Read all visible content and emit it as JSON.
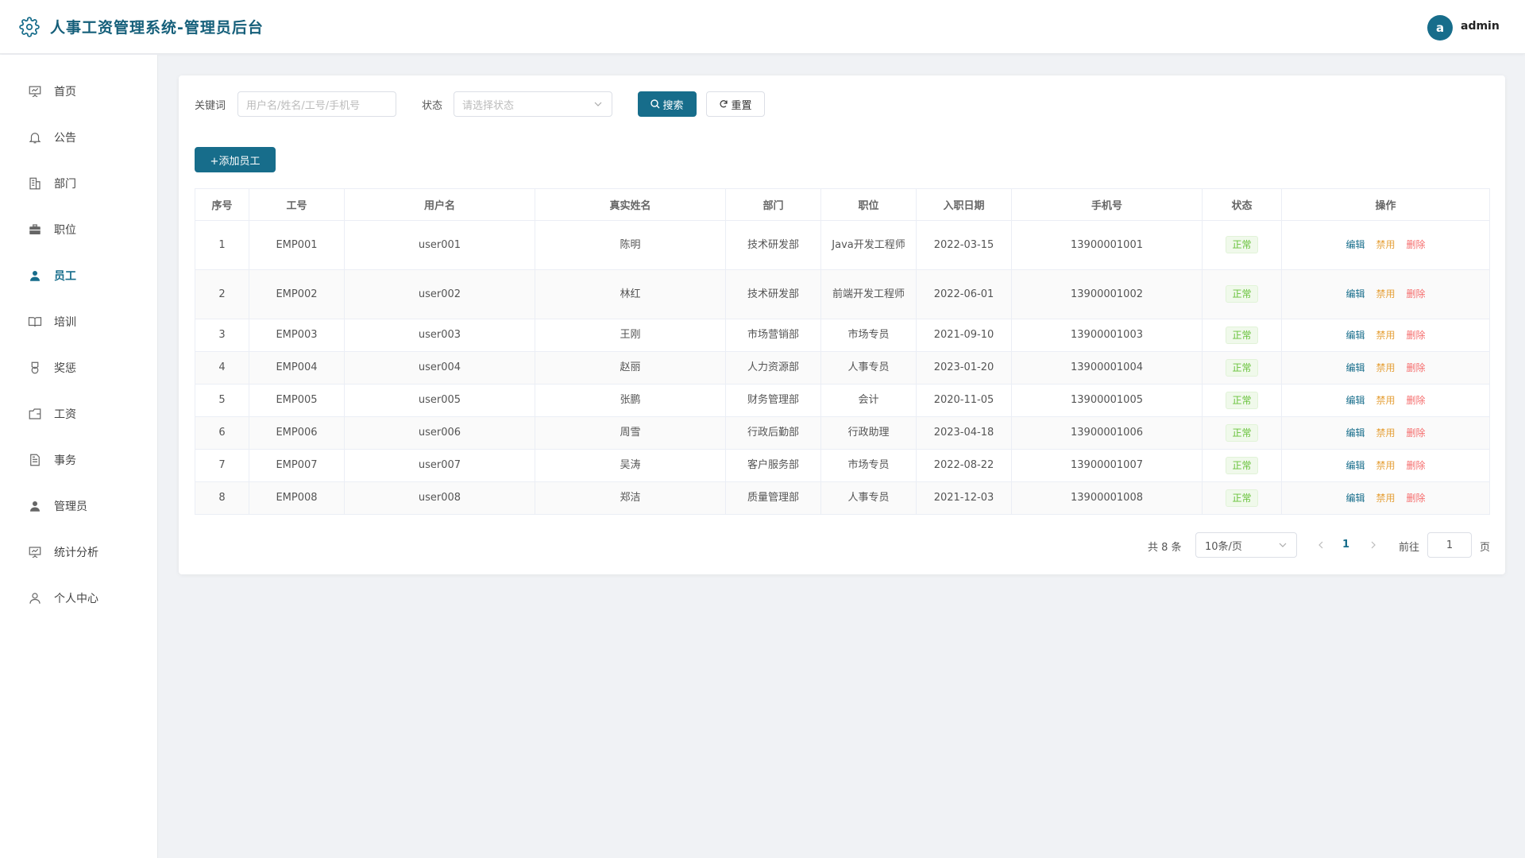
{
  "header": {
    "title": "人事工资管理系统-管理员后台",
    "avatar_letter": "a",
    "username": "admin"
  },
  "sidebar": {
    "items": [
      {
        "label": "首页",
        "icon": "presentation-icon"
      },
      {
        "label": "公告",
        "icon": "bell-icon"
      },
      {
        "label": "部门",
        "icon": "building-icon"
      },
      {
        "label": "职位",
        "icon": "briefcase-icon"
      },
      {
        "label": "员工",
        "icon": "user-icon"
      },
      {
        "label": "培训",
        "icon": "book-icon"
      },
      {
        "label": "奖惩",
        "icon": "medal-icon"
      },
      {
        "label": "工资",
        "icon": "wallet-icon"
      },
      {
        "label": "事务",
        "icon": "document-icon"
      },
      {
        "label": "管理员",
        "icon": "user-icon"
      },
      {
        "label": "统计分析",
        "icon": "presentation-icon"
      },
      {
        "label": "个人中心",
        "icon": "user-outline-icon"
      }
    ],
    "active": "员工"
  },
  "filters": {
    "keyword_label": "关键词",
    "keyword_placeholder": "用户名/姓名/工号/手机号",
    "status_label": "状态",
    "status_placeholder": "请选择状态",
    "search_label": "搜索",
    "reset_label": "重置"
  },
  "add_button_label": "+添加员工",
  "table": {
    "columns": [
      "序号",
      "工号",
      "用户名",
      "真实姓名",
      "部门",
      "职位",
      "入职日期",
      "手机号",
      "状态",
      "操作"
    ],
    "rows": [
      {
        "idx": "1",
        "emp_no": "EMP001",
        "username": "user001",
        "name": "陈明",
        "dept": "技术研发部",
        "position": "Java开发工程师",
        "hire_date": "2022-03-15",
        "phone": "13900001001",
        "status": "正常"
      },
      {
        "idx": "2",
        "emp_no": "EMP002",
        "username": "user002",
        "name": "林红",
        "dept": "技术研发部",
        "position": "前端开发工程师",
        "hire_date": "2022-06-01",
        "phone": "13900001002",
        "status": "正常"
      },
      {
        "idx": "3",
        "emp_no": "EMP003",
        "username": "user003",
        "name": "王刚",
        "dept": "市场营销部",
        "position": "市场专员",
        "hire_date": "2021-09-10",
        "phone": "13900001003",
        "status": "正常"
      },
      {
        "idx": "4",
        "emp_no": "EMP004",
        "username": "user004",
        "name": "赵丽",
        "dept": "人力资源部",
        "position": "人事专员",
        "hire_date": "2023-01-20",
        "phone": "13900001004",
        "status": "正常"
      },
      {
        "idx": "5",
        "emp_no": "EMP005",
        "username": "user005",
        "name": "张鹏",
        "dept": "财务管理部",
        "position": "会计",
        "hire_date": "2020-11-05",
        "phone": "13900001005",
        "status": "正常"
      },
      {
        "idx": "6",
        "emp_no": "EMP006",
        "username": "user006",
        "name": "周雪",
        "dept": "行政后勤部",
        "position": "行政助理",
        "hire_date": "2023-04-18",
        "phone": "13900001006",
        "status": "正常"
      },
      {
        "idx": "7",
        "emp_no": "EMP007",
        "username": "user007",
        "name": "吴涛",
        "dept": "客户服务部",
        "position": "市场专员",
        "hire_date": "2022-08-22",
        "phone": "13900001007",
        "status": "正常"
      },
      {
        "idx": "8",
        "emp_no": "EMP008",
        "username": "user008",
        "name": "郑洁",
        "dept": "质量管理部",
        "position": "人事专员",
        "hire_date": "2021-12-03",
        "phone": "13900001008",
        "status": "正常"
      }
    ],
    "actions": {
      "edit": "编辑",
      "disable": "禁用",
      "delete": "删除"
    }
  },
  "pagination": {
    "total_text": "共 8 条",
    "page_size": "10条/页",
    "current_page": "1",
    "goto_label": "前往",
    "goto_value": "1",
    "page_suffix": "页"
  },
  "colors": {
    "primary": "#176d8b",
    "success": "#67c23a",
    "warning": "#e6a23c",
    "danger": "#f56c6c"
  }
}
